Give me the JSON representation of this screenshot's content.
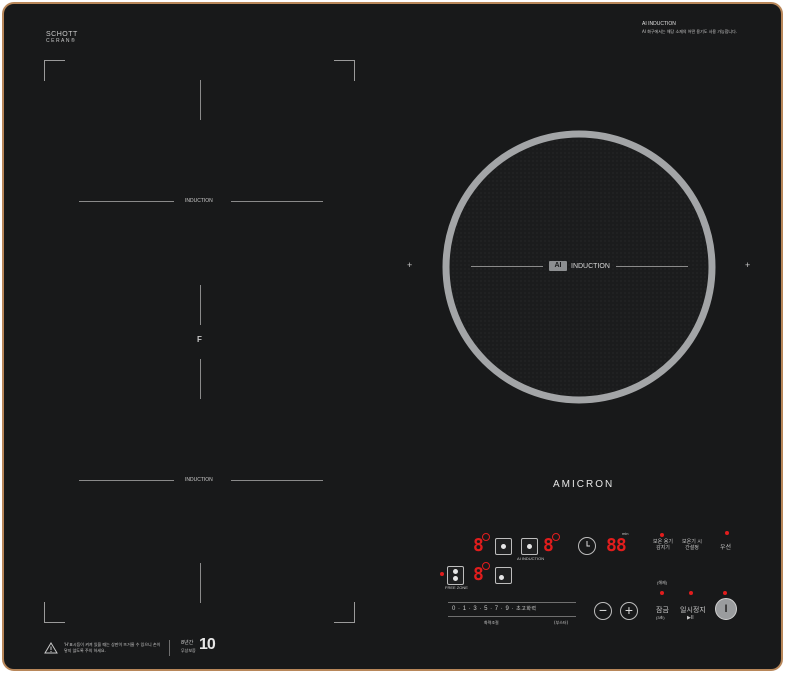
{
  "brand": {
    "line1": "SCHOTT",
    "line2": "CERAN®"
  },
  "ai_notice": {
    "title": "AI INDUCTION",
    "body": "AI 화구에서는 해당 소재의 어떤 용기도 사용 가능합니다."
  },
  "left_zone": {
    "top_label": "INDUCTION",
    "bottom_label": "INDUCTION",
    "flex_mark": "F"
  },
  "right_zone": {
    "badge": "AI",
    "label": "INDUCTION",
    "plus_left": "+",
    "plus_right": "+"
  },
  "logo": "AMICRON",
  "controls": {
    "digit": "8",
    "ai_induction_label": "AI INDUCTION",
    "flex_zone_label": "FREE ZONE",
    "timer_digits": "88",
    "timer_small": "min",
    "btn_keep_warm": "보온 용기 감지기",
    "btn_time_setting": "보온기 시간설정",
    "btn_priority": "우선",
    "scale": [
      "0",
      "·",
      "1",
      "·",
      "3",
      "·",
      "5",
      "·",
      "7",
      "·",
      "9",
      "·",
      "초고화력"
    ],
    "scale_sub_left": "화력조절",
    "scale_sub_right": "(부스터)",
    "minus": "−",
    "plus": "+",
    "lock_label": "잠금",
    "lock_sub": "(3초)",
    "lock_small": "(해제)",
    "pause_label": "일시정지",
    "pause_sub": "▶II",
    "power_symbol": "I"
  },
  "footer": {
    "warning": "'H'표시등이 켜져 있을 때는 상판이 뜨거울 수 있으니 손이 닿지 않도록 주의 하세요.",
    "years_top": "8년간",
    "years_sub": "무상보증",
    "years_number": "10"
  }
}
